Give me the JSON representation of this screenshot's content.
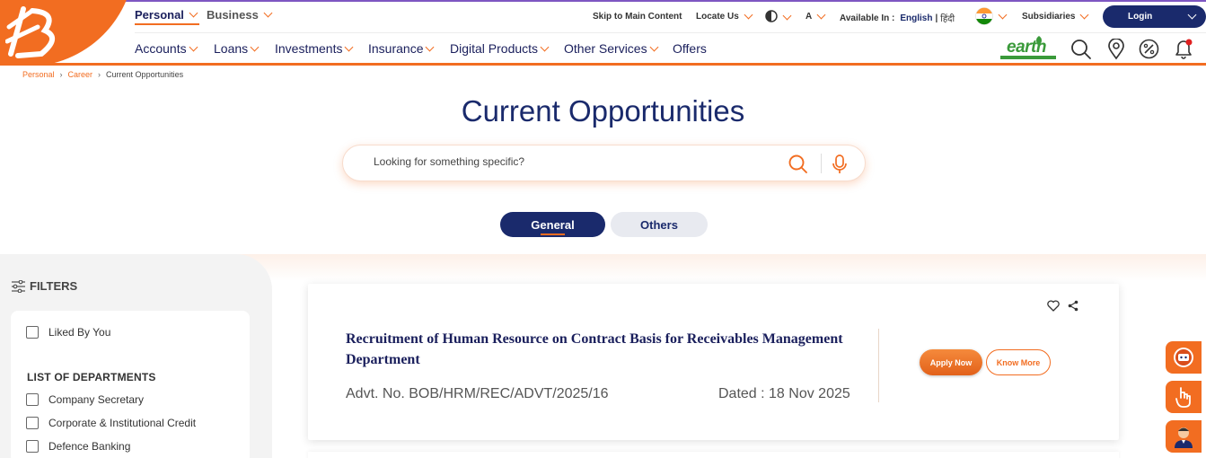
{
  "header": {
    "segments": [
      {
        "label": "Personal",
        "active": true
      },
      {
        "label": "Business",
        "active": false
      }
    ],
    "utility": {
      "skip_label": "Skip to Main Content",
      "locate_label": "Locate Us",
      "font_label": "A",
      "available_label": "Available In :",
      "lang_english": "English",
      "lang_separator": "|",
      "lang_hindi": "हिंदी",
      "subsidiaries_label": "Subsidiaries",
      "login_label": "Login"
    },
    "nav": [
      "Accounts",
      "Loans",
      "Investments",
      "Insurance",
      "Digital Products",
      "Other Services",
      "Offers"
    ],
    "earth_logo_text": "earth"
  },
  "breadcrumb": [
    "Personal",
    "Career",
    "Current Opportunities"
  ],
  "page": {
    "title": "Current Opportunities",
    "search_placeholder": "Looking for something specific?"
  },
  "tabs": [
    "General",
    "Others"
  ],
  "filters": {
    "title": "FILTERS",
    "liked_label": "Liked By You",
    "departments_title": "LIST OF DEPARTMENTS",
    "departments": [
      "Company Secretary",
      "Corporate & Institutional Credit",
      "Defence Banking"
    ]
  },
  "job": {
    "title": "Recruitment of Human Resource on Contract Basis for Receivables Management Department",
    "advt": "Advt. No. BOB/HRM/REC/ADVT/2025/16",
    "date": "Dated : 18 Nov 2025",
    "apply_label": "Apply Now",
    "know_label": "Know More"
  },
  "colors": {
    "brand_orange": "#f26d21",
    "brand_navy": "#1a2a6c"
  }
}
